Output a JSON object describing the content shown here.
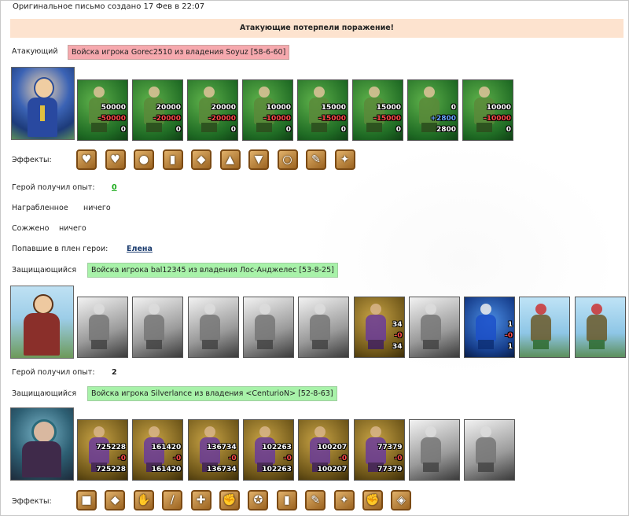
{
  "header": {
    "created": "Оригинальное письмо создано 17 Фев в 22:07",
    "result_banner": "Атакующие потерпели поражение!"
  },
  "attacker": {
    "label": "Атакующий",
    "army": "Войска игрока Gorec2510 из владения Soyuz [58-6-60]",
    "units": [
      {
        "icon": "dwarf-warrior",
        "n1": "50000",
        "n2": "-50000",
        "n3": "0"
      },
      {
        "icon": "knight-swordsman",
        "n1": "20000",
        "n2": "-20000",
        "n3": "0"
      },
      {
        "icon": "paladin",
        "n1": "20000",
        "n2": "-20000",
        "n3": "0"
      },
      {
        "icon": "griffin",
        "n1": "10000",
        "n2": "-10000",
        "n3": "0"
      },
      {
        "icon": "archer",
        "n1": "15000",
        "n2": "-15000",
        "n3": "0"
      },
      {
        "icon": "elf-archer",
        "n1": "15000",
        "n2": "-15000",
        "n3": "0"
      },
      {
        "icon": "green-mage",
        "n1": "0",
        "n2": "+2800",
        "n3": "2800"
      },
      {
        "icon": "druid",
        "n1": "10000",
        "n2": "-10000",
        "n3": "0"
      }
    ],
    "effects_label": "Эффекты:",
    "effects": [
      "heart-icon",
      "hearts-icon",
      "potion-icon",
      "armor-icon",
      "shield-icon",
      "helmet-icon",
      "boots-icon",
      "ring-icon",
      "scroll-icon",
      "claw-icon"
    ],
    "xp_label": "Герой получил опыт:",
    "xp_value": "0",
    "looted_label": "Награбленное",
    "looted_value": "ничего",
    "burned_label": "Сожжено",
    "burned_value": "ничего",
    "captured_label": "Попавшие в плен герои:",
    "captured_value": "Елена"
  },
  "defender1": {
    "label": "Защищающийся",
    "army": "Войска игрока bal12345 из владения Лос-Анджелес [53-8-25]",
    "units": [
      {
        "icon": "gray-unit-1",
        "n1": "",
        "n2": "",
        "n3": ""
      },
      {
        "icon": "gray-unit-2",
        "n1": "",
        "n2": "",
        "n3": ""
      },
      {
        "icon": "gray-unit-3",
        "n1": "",
        "n2": "",
        "n3": ""
      },
      {
        "icon": "gray-unit-4",
        "n1": "",
        "n2": "",
        "n3": ""
      },
      {
        "icon": "gray-unit-5",
        "n1": "",
        "n2": "",
        "n3": ""
      },
      {
        "icon": "hooded-mage",
        "n1": "34",
        "n2": "-0",
        "n3": "34"
      },
      {
        "icon": "gray-unit-6",
        "n1": "",
        "n2": "",
        "n3": ""
      },
      {
        "icon": "wizard",
        "n1": "1",
        "n2": "-0",
        "n3": "1"
      },
      {
        "icon": "tower-1",
        "n1": "",
        "n2": "",
        "n3": ""
      },
      {
        "icon": "tower-2",
        "n1": "",
        "n2": "",
        "n3": ""
      }
    ],
    "xp_label": "Герой получил опыт:",
    "xp_value": "2"
  },
  "defender2": {
    "label": "Защищающийся",
    "army": "Войска игрока Silverlance из владения <CenturioN> [52-8-63]",
    "units": [
      {
        "icon": "ogre",
        "n1": "725228",
        "n2": "-0",
        "n3": "725228"
      },
      {
        "icon": "dark-elf-1",
        "n1": "161420",
        "n2": "-0",
        "n3": "161420"
      },
      {
        "icon": "dark-elf-2",
        "n1": "136734",
        "n2": "-0",
        "n3": "136734"
      },
      {
        "icon": "harpy",
        "n1": "102263",
        "n2": "-0",
        "n3": "102263"
      },
      {
        "icon": "dark-archer",
        "n1": "100207",
        "n2": "-0",
        "n3": "100207"
      },
      {
        "icon": "warlock",
        "n1": "77379",
        "n2": "-0",
        "n3": "77379"
      },
      {
        "icon": "gray-assassin",
        "n1": "",
        "n2": "",
        "n3": ""
      },
      {
        "icon": "gray-spider",
        "n1": "",
        "n2": "",
        "n3": ""
      }
    ],
    "effects_label": "Эффекты:",
    "effects": [
      "dice-icon",
      "shield-icon",
      "hand-icon",
      "sword-icon",
      "handshake-icon",
      "arm-icon",
      "amulet-icon",
      "armor-icon",
      "scroll-icon",
      "claw-icon",
      "fist-icon",
      "gem-icon"
    ]
  },
  "colors": {
    "banner_bg": "#fde3cf",
    "attacker_army_bg": "#f6a9ae",
    "defender_army_bg": "#a8f2a9",
    "xp_link": "#1aaa1a"
  }
}
